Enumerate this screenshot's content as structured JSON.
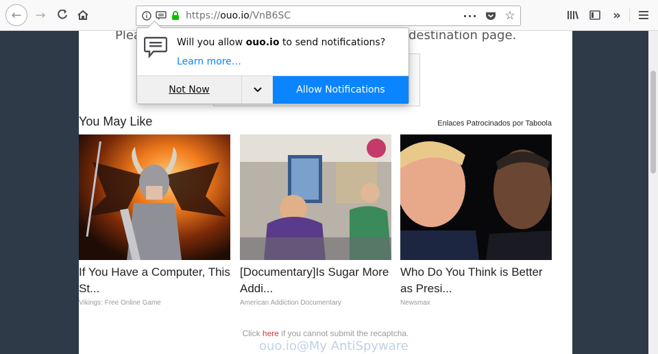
{
  "browser": {
    "url_prefix": "https://",
    "url_domain": "ouo.io",
    "url_path": "/VnB6SC"
  },
  "page": {
    "headline_left": "Plea",
    "headline_right": "destination page.",
    "section_title": "You May Like",
    "sponsor_label": "Enlaces Patrocinados por Taboola",
    "cards": [
      {
        "title": "If You Have a Computer, This St...",
        "source": "Vikings: Free Online Game"
      },
      {
        "title": "[Documentary]Is Sugar More Addi...",
        "source": "American Addiction Documentary"
      },
      {
        "title": "Who Do You Think is Better as Presi...",
        "source": "Newsmax"
      }
    ],
    "footer_prefix": "Click ",
    "footer_link": "here",
    "footer_suffix": " if you cannot submit the recaptcha."
  },
  "popup": {
    "msg_prefix": "Will you allow ",
    "msg_site": "ouo.io",
    "msg_suffix": " to send notifications?",
    "learn_more": "Learn more…",
    "not_now": "Not Now",
    "allow": "Allow Notifications"
  },
  "watermark": "ouo.io@My AntiSpyware",
  "colors": {
    "accent": "#0a84ff",
    "page_bg": "#2e3a48",
    "secure_lock": "#12bc00",
    "link_red": "#e03030"
  }
}
